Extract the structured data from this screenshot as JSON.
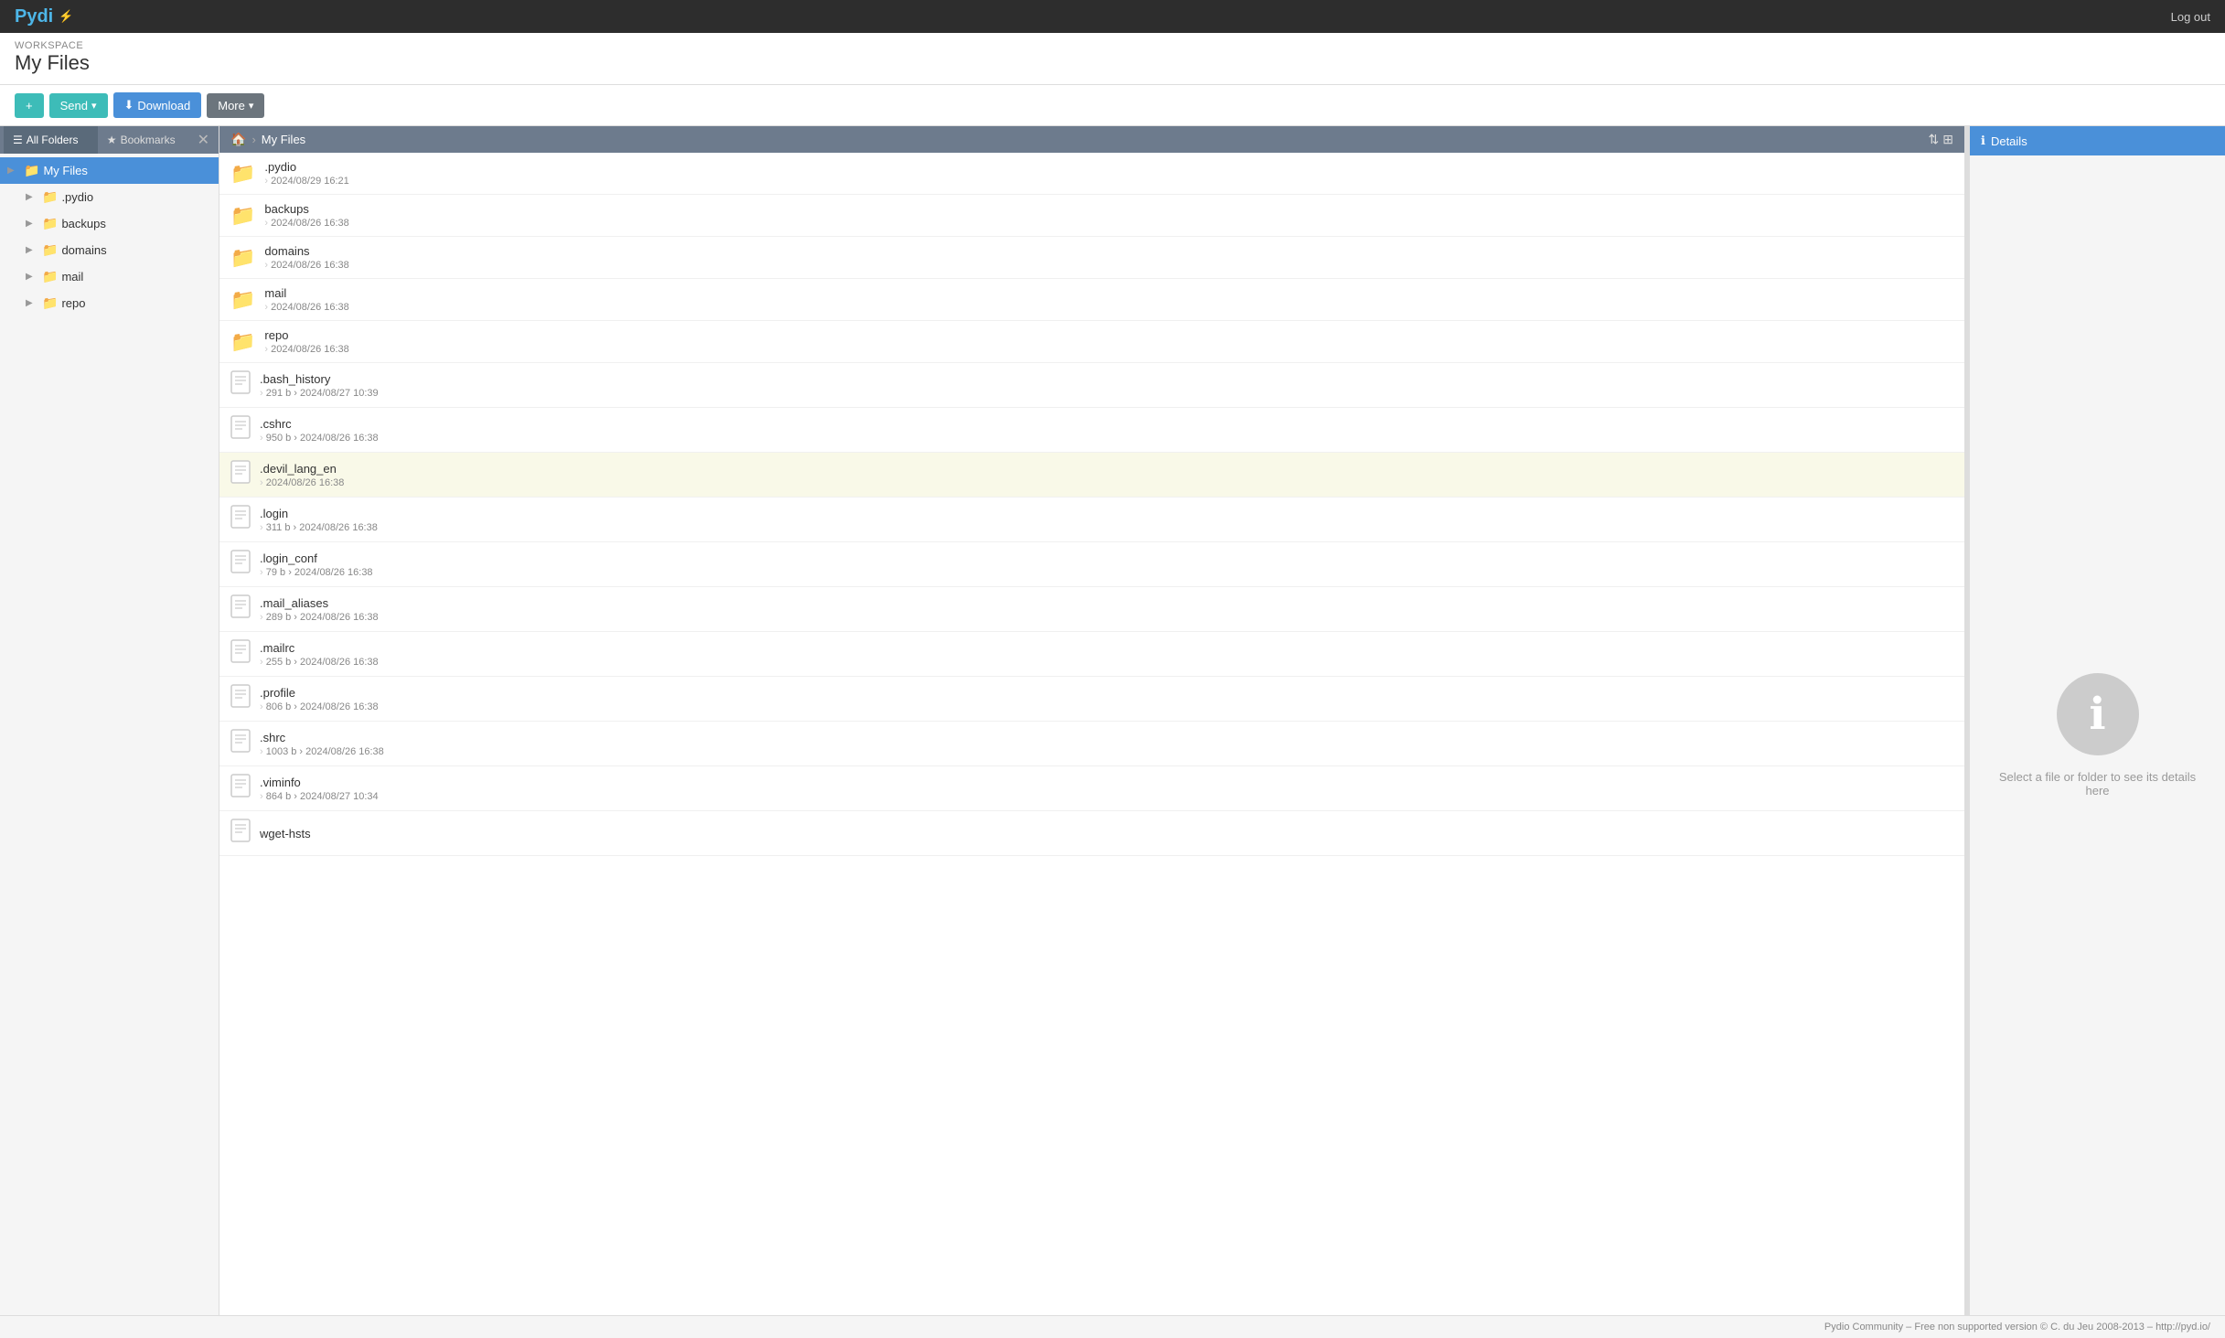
{
  "topbar": {
    "logo_text": "Pydi",
    "logo_icon": "⚡",
    "logout_label": "Log out"
  },
  "workspace": {
    "label": "Workspace",
    "title": "My Files"
  },
  "toolbar": {
    "add_label": "+",
    "send_label": "Send",
    "download_label": "Download",
    "more_label": "More"
  },
  "breadcrumb": {
    "home_icon": "🏠",
    "separator": "›",
    "path": "My Files",
    "sort_icon": "⇅",
    "view_icon": "⊞"
  },
  "sidebar": {
    "tab_all": "All Folders",
    "tab_bookmarks": "Bookmarks",
    "tab_all_icon": "☰",
    "tab_bookmarks_icon": "★",
    "close_icon": "✕",
    "items": [
      {
        "label": "My Files",
        "icon": "folder",
        "active": true,
        "depth": 0
      },
      {
        "label": ".pydio",
        "icon": "folder",
        "active": false,
        "depth": 1
      },
      {
        "label": "backups",
        "icon": "folder",
        "active": false,
        "depth": 1
      },
      {
        "label": "domains",
        "icon": "folder",
        "active": false,
        "depth": 1
      },
      {
        "label": "mail",
        "icon": "folder",
        "active": false,
        "depth": 1
      },
      {
        "label": "repo",
        "icon": "folder",
        "active": false,
        "depth": 1
      }
    ]
  },
  "files": [
    {
      "name": ".pydio",
      "type": "folder",
      "meta": "2024/08/29 16:21",
      "selected": false
    },
    {
      "name": "backups",
      "type": "folder",
      "meta": "2024/08/26 16:38",
      "selected": false
    },
    {
      "name": "domains",
      "type": "folder",
      "meta": "2024/08/26 16:38",
      "selected": false
    },
    {
      "name": "mail",
      "type": "folder",
      "meta": "2024/08/26 16:38",
      "selected": false
    },
    {
      "name": "repo",
      "type": "folder",
      "meta": "2024/08/26 16:38",
      "selected": false
    },
    {
      "name": ".bash_history",
      "type": "file",
      "meta": "291 b › 2024/08/27 10:39",
      "selected": false
    },
    {
      "name": ".cshrc",
      "type": "file",
      "meta": "950 b › 2024/08/26 16:38",
      "selected": false
    },
    {
      "name": ".devil_lang_en",
      "type": "file",
      "meta": "2024/08/26 16:38",
      "selected": true
    },
    {
      "name": ".login",
      "type": "file",
      "meta": "311 b › 2024/08/26 16:38",
      "selected": false
    },
    {
      "name": ".login_conf",
      "type": "file",
      "meta": "79 b › 2024/08/26 16:38",
      "selected": false
    },
    {
      "name": ".mail_aliases",
      "type": "file",
      "meta": "289 b › 2024/08/26 16:38",
      "selected": false
    },
    {
      "name": ".mailrc",
      "type": "file",
      "meta": "255 b › 2024/08/26 16:38",
      "selected": false
    },
    {
      "name": ".profile",
      "type": "file",
      "meta": "806 b › 2024/08/26 16:38",
      "selected": false
    },
    {
      "name": ".shrc",
      "type": "file",
      "meta": "1003 b › 2024/08/26 16:38",
      "selected": false
    },
    {
      "name": ".viminfo",
      "type": "file",
      "meta": "864 b › 2024/08/27 10:34",
      "selected": false
    },
    {
      "name": "wget-hsts",
      "type": "file",
      "meta": "",
      "selected": false
    }
  ],
  "details": {
    "header": "Details",
    "info_icon": "ℹ",
    "placeholder": "Select a file or folder to see its details here"
  },
  "footer": {
    "text": "Pydio Community – Free non supported version © C. du Jeu 2008-2013 – http://pyd.io/"
  }
}
